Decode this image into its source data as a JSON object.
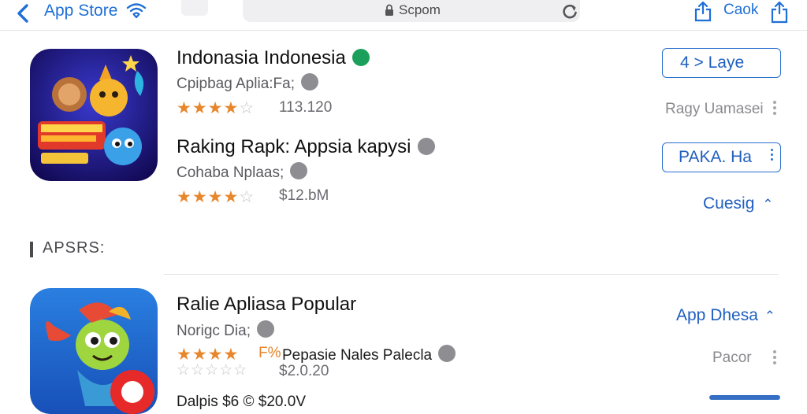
{
  "nav": {
    "back_label": "App Store",
    "address_text": "Scpom",
    "right_label": "Caok"
  },
  "apps": [
    {
      "title": "Indonasia Indonesia",
      "subtitle": "Cpipbag Aplia:Fa;",
      "rating": 4,
      "meta": "113.120",
      "button_label": "4 > Laye",
      "side_text": "Ragy Uamasei"
    },
    {
      "title": "Raking Rapk: Appsia kapysi",
      "subtitle": "Cohaba Nplaas;",
      "rating": 4,
      "meta": "$12.bM",
      "button_label": "PAKA. Ha",
      "side_link": "Cuesig"
    },
    {
      "title": "Ralie Apliasa Popular",
      "subtitle": "Norigc Dia;",
      "rating": 4,
      "star_tail": "F%",
      "extra_text": "Pepasie Nales Palecla",
      "meta": "$2.0.20",
      "side_link": "App Dhesa",
      "side_text": "Pacor",
      "partial_text": "Dalpis $6 ©   $20.0V"
    }
  ],
  "section": {
    "label": "APSRS:"
  },
  "colors": {
    "accent": "#1f6fd6",
    "star": "#e8862b",
    "verified": "#1aa05a"
  },
  "icons": {
    "back": "chevron-left-icon",
    "wifi": "wifi-icon",
    "lock": "lock-icon",
    "reload": "reload-icon",
    "share": "share-icon",
    "verified": "verified-check-icon",
    "more": "more-dots-icon"
  }
}
